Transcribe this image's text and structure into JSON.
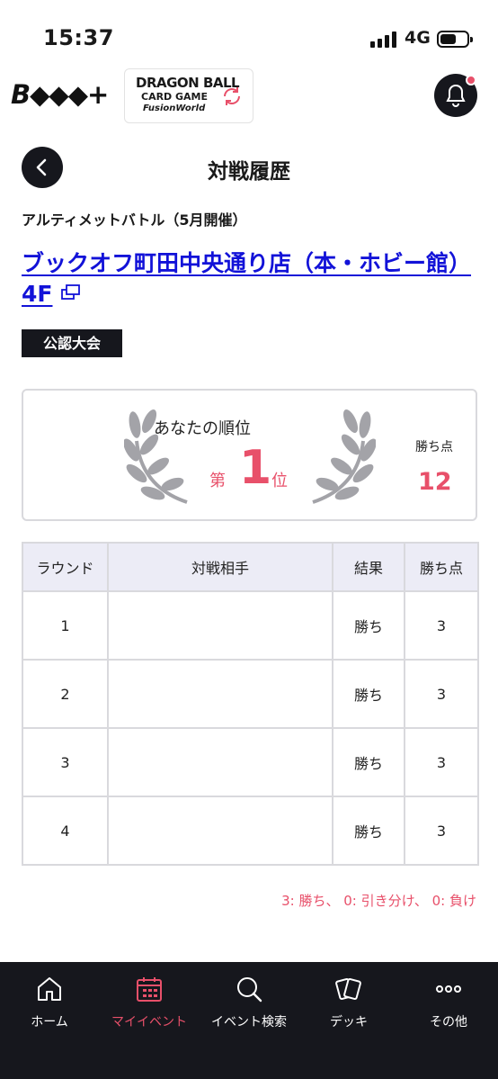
{
  "status_bar": {
    "time": "15:37",
    "network": "4G",
    "battery_level": 0.6
  },
  "header": {
    "brand_logo_text": "B◆◆◆+",
    "game_logo": {
      "line1": "DRAGON BALL",
      "line2": "CARD GAME",
      "line3": "FusionWorld"
    },
    "notification_badge_color": "#e8506a"
  },
  "page": {
    "title": "対戦履歴",
    "event_name": "アルティメットバトル（5月開催）",
    "store_name": "ブックオフ町田中央通り店（本・ホビー館）4F",
    "badge": "公認大会"
  },
  "rank_card": {
    "label": "あなたの順位",
    "prefix": "第",
    "rank": "1",
    "suffix": "位",
    "points_label": "勝ち点",
    "points": "12"
  },
  "results_table": {
    "headers": [
      "ラウンド",
      "対戦相手",
      "結果",
      "勝ち点"
    ],
    "rows": [
      {
        "round": "1",
        "opponent": "",
        "result": "勝ち",
        "points": "3"
      },
      {
        "round": "2",
        "opponent": "",
        "result": "勝ち",
        "points": "3"
      },
      {
        "round": "3",
        "opponent": "",
        "result": "勝ち",
        "points": "3"
      },
      {
        "round": "4",
        "opponent": "",
        "result": "勝ち",
        "points": "3"
      }
    ],
    "legend": "3: 勝ち、 0: 引き分け、 0: 負け"
  },
  "bottom_nav": {
    "items": [
      {
        "label": "ホーム",
        "icon": "home-icon"
      },
      {
        "label": "マイイベント",
        "icon": "calendar-icon",
        "active": true
      },
      {
        "label": "イベント検索",
        "icon": "search-icon"
      },
      {
        "label": "デッキ",
        "icon": "cards-icon"
      },
      {
        "label": "その他",
        "icon": "more-icon"
      }
    ],
    "active_color": "#e8506a"
  },
  "colors": {
    "accent": "#e8506a",
    "dark": "#16171d",
    "link": "#1212d8",
    "table_header_bg": "#ececf6"
  }
}
